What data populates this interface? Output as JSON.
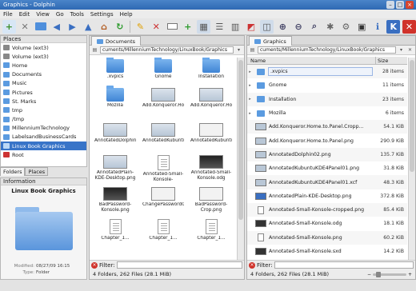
{
  "window": {
    "title": "Graphics - Dolphin"
  },
  "menu": [
    "File",
    "Edit",
    "View",
    "Go",
    "Tools",
    "Settings",
    "Help"
  ],
  "places": {
    "header": "Places",
    "items": [
      "Volume (ext3)",
      "Volume (ext3)",
      "Home",
      "Documents",
      "Music",
      "Pictures",
      "St. Marks",
      "tmp",
      "/tmp",
      "MillenniumTechnology",
      "LabelsandBusinessCards",
      "Linux Book Graphics",
      "Root"
    ],
    "selected_index": 11
  },
  "panel_tabs": [
    "Folders",
    "Places"
  ],
  "info": {
    "header": "Information",
    "title": "Linux Book Graphics",
    "modified_label": "Modified:",
    "modified": "08/27/09 16:15",
    "type_label": "Type:",
    "type": "Folder"
  },
  "left_pane": {
    "tab1": "Documents",
    "url": "cuments/MillenniumTechnology/LinuxBook/Graphics",
    "items": [
      ".xvpics",
      "Gnome",
      "Installation",
      "Mozilla",
      "Add.Konqueror.Home.to.Panel.Cropped.png",
      "Add.Konqueror.Home.to.Panel.png",
      "AnnotatedDolphin02.png",
      "AnnotatedKubuntuKDE4Panel01.png",
      "AnnotatedKubuntuKDE4Panel01.xcf",
      "AnnotatedPlain-KDE-Desktop.png",
      "Annotated-Small-Konsole-cropped.png",
      "Annotated-Small-Konsole.odg",
      "BadPassword-Konsole.png",
      "ChangePassword01.png",
      "BadPassword-Crop.png",
      "Chapter_1...",
      "Chapter_1...",
      "Chapter_1..."
    ],
    "status": "4 Folders, 262 Files (28.1 MiB)"
  },
  "right_pane": {
    "tab1": "Graphics",
    "url": "cuments/MillenniumTechnology/LinuxBook/Graphics",
    "col_name": "Name",
    "col_size": "Size",
    "rows": [
      {
        "name": ".xvpics",
        "size": "28 items"
      },
      {
        "name": "Gnome",
        "size": "11 items"
      },
      {
        "name": "Installation",
        "size": "23 items"
      },
      {
        "name": "Mozilla",
        "size": "6 items"
      },
      {
        "name": "Add.Konqueror.Home.to.Panel.Cropp...",
        "size": "54.1 KiB"
      },
      {
        "name": "Add.Konqueror.Home.to.Panel.png",
        "size": "290.9 KiB"
      },
      {
        "name": "AnnotatedDolphin02.png",
        "size": "135.7 KiB"
      },
      {
        "name": "AnnotatedKubuntuKDE4Panel01.png",
        "size": "31.8 KiB"
      },
      {
        "name": "AnnotatedKubuntuKDE4Panel01.xcf",
        "size": "48.3 KiB"
      },
      {
        "name": "AnnotatedPlain-KDE-Desktop.png",
        "size": "372.8 KiB"
      },
      {
        "name": "Annotated-Small-Konsole-cropped.png",
        "size": "85.4 KiB"
      },
      {
        "name": "Annotated-Small-Konsole.odg",
        "size": "18.1 KiB"
      },
      {
        "name": "Annotated-Small-Konsole.png",
        "size": "60.2 KiB"
      },
      {
        "name": "Annotated-Small-Konsole.sxd",
        "size": "14.2 KiB"
      }
    ],
    "status": "4 Folders, 262 Files (28.1 MiB)"
  },
  "filter_label": "Filter:"
}
